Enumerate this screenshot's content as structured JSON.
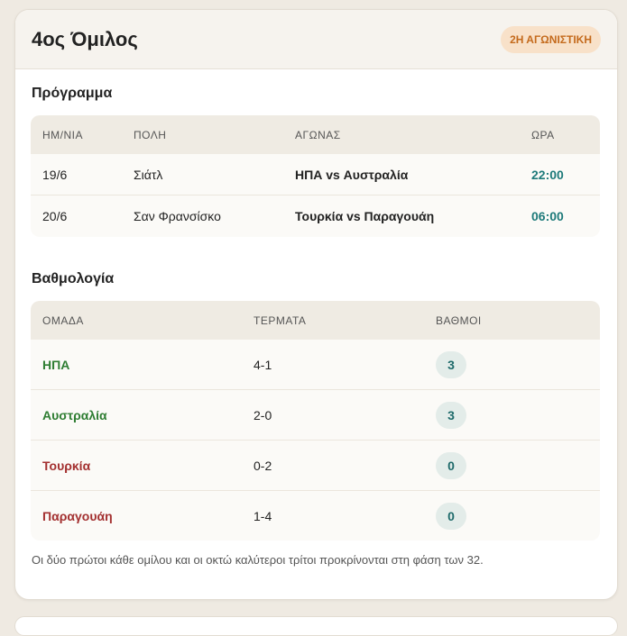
{
  "group": {
    "title": "4ος Όμιλος",
    "badge": "2Η ΑΓΩΝΙΣΤΙΚΗ"
  },
  "schedule": {
    "title": "Πρόγραμμα",
    "headers": {
      "date": "ΗΜ/ΝΙΑ",
      "city": "ΠΟΛΗ",
      "match": "ΑΓΩΝΑΣ",
      "time": "ΩΡΑ"
    },
    "rows": [
      {
        "date": "19/6",
        "city": "Σιάτλ",
        "match": "ΗΠΑ vs Αυστραλία",
        "time": "22:00"
      },
      {
        "date": "20/6",
        "city": "Σαν Φρανσίσκο",
        "match": "Τουρκία vs Παραγουάη",
        "time": "06:00"
      }
    ]
  },
  "standings": {
    "title": "Βαθμολογία",
    "headers": {
      "team": "ΟΜΑΔΑ",
      "goals": "ΤΕΡΜΑΤΑ",
      "points": "ΒΑΘΜΟΙ"
    },
    "rows": [
      {
        "team": "ΗΠΑ",
        "goals": "4-1",
        "points": "3"
      },
      {
        "team": "Αυστραλία",
        "goals": "2-0",
        "points": "3"
      },
      {
        "team": "Τουρκία",
        "goals": "0-2",
        "points": "0"
      },
      {
        "team": "Παραγουάη",
        "goals": "1-4",
        "points": "0"
      }
    ]
  },
  "note": "Οι δύο πρώτοι κάθε ομίλου και οι οκτώ καλύτεροι τρίτοι προκρίνονται στη φάση των 32.",
  "colors": {
    "accent_time": "#1e7a7a",
    "qualified": "#2e7d32",
    "eliminated": "#a33030",
    "badge_bg": "#f8e1c9",
    "badge_text": "#c46a1c"
  }
}
